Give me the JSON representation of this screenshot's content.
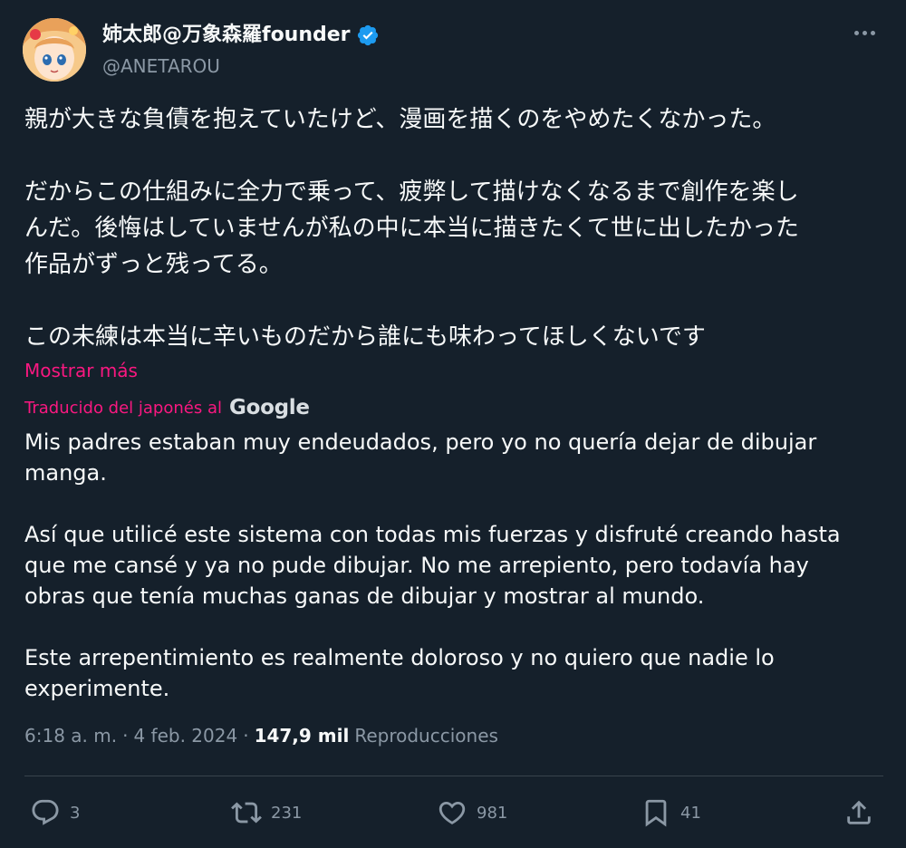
{
  "user": {
    "display_name": "姉太郎@万象森羅founder",
    "handle": "@ANETAROU",
    "verified_icon": "verified-badge-icon",
    "avatar_icon": "avatar"
  },
  "tweet": {
    "jp_lines": [
      "親が大きな負債を抱えていたけど、漫画を描くのをやめたくなかった。",
      "だからこの仕組みに全力で乗って、疲弊して描けなくなるまで創作を楽し",
      "んだ。後悔はしていませんが私の中に本当に描きたくて世に出したかった",
      "作品がずっと残ってる。",
      "この未練は本当に辛いものだから誰にも味わってほしくないです"
    ],
    "show_more": "Mostrar más",
    "translated_by": "Traducido del japonés al",
    "translator_brand": "Google",
    "es_lines": [
      "Mis padres estaban muy endeudados, pero yo no quería dejar de dibujar",
      "manga.",
      "Así que utilicé este sistema con todas mis fuerzas y disfruté creando hasta",
      "que me cansé y ya no pude dibujar. No me arrepiento, pero todavía hay",
      "obras que tenía muchas ganas de dibujar y mostrar al mundo.",
      "Este arrepentimiento es realmente doloroso y no quiero que nadie lo",
      "experimente."
    ]
  },
  "meta": {
    "time": "6:18 a. m.",
    "sep1": "·",
    "date": "4 feb. 2024",
    "sep2": "·",
    "views": "147,9 mil",
    "views_label": "Reproducciones"
  },
  "actions": {
    "replies": "3",
    "reposts": "231",
    "likes": "981",
    "bookmarks": "41"
  },
  "colors": {
    "background": "#15202b",
    "accent_pink": "#f91880",
    "muted": "#8b98a5",
    "verified": "#1d9bf0"
  }
}
